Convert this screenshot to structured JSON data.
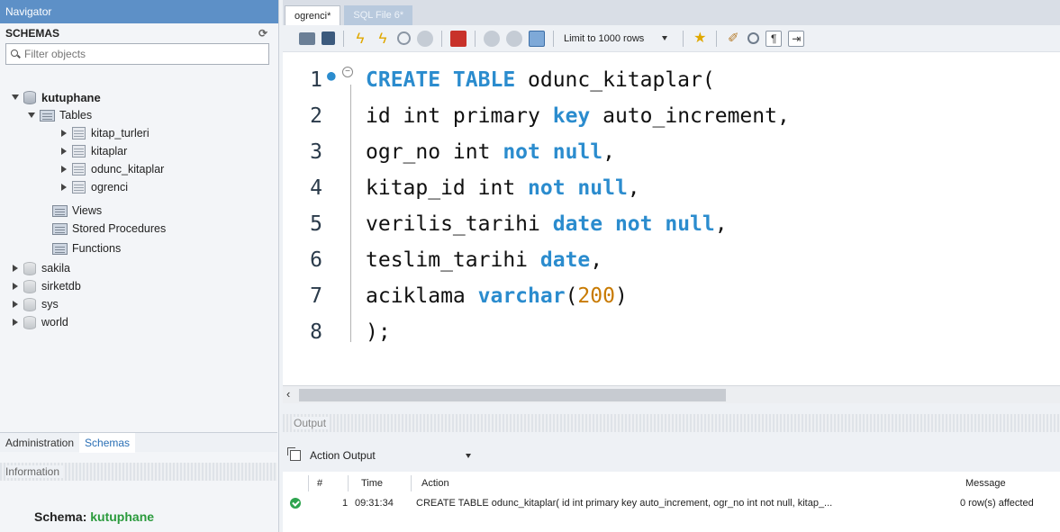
{
  "navigator": {
    "title": "Navigator",
    "schemas_label": "SCHEMAS",
    "filter_placeholder": "Filter objects",
    "tree": {
      "kutuphane": "kutuphane",
      "tables": "Tables",
      "table_items": [
        "kitap_turleri",
        "kitaplar",
        "odunc_kitaplar",
        "ogrenci"
      ],
      "views": "Views",
      "stored_procedures": "Stored Procedures",
      "functions": "Functions",
      "other_schemas": [
        "sakila",
        "sirketdb",
        "sys",
        "world"
      ]
    },
    "tabs": {
      "administration": "Administration",
      "schemas": "Schemas"
    },
    "information_label": "Information",
    "schema_prefix": "Schema:",
    "schema_name": "kutuphane"
  },
  "editor_tabs": [
    "ogrenci*",
    "SQL File 6*"
  ],
  "toolbar": {
    "limit_label": "Limit to 1000 rows"
  },
  "code": {
    "line_numbers": [
      "1",
      "2",
      "3",
      "4",
      "5",
      "6",
      "7",
      "8"
    ],
    "lines": [
      [
        {
          "t": "CREATE TABLE",
          "k": "kw"
        },
        {
          "t": " odunc_kitaplar(",
          "k": ""
        }
      ],
      [
        {
          "t": "id int primary ",
          "k": ""
        },
        {
          "t": "key",
          "k": "kw"
        },
        {
          "t": " auto_increment,",
          "k": ""
        }
      ],
      [
        {
          "t": "ogr_no int ",
          "k": ""
        },
        {
          "t": "not null",
          "k": "kw"
        },
        {
          "t": ",",
          "k": ""
        }
      ],
      [
        {
          "t": "kitap_id int ",
          "k": ""
        },
        {
          "t": "not null",
          "k": "kw"
        },
        {
          "t": ",",
          "k": ""
        }
      ],
      [
        {
          "t": "verilis_tarihi ",
          "k": ""
        },
        {
          "t": "date not null",
          "k": "kw"
        },
        {
          "t": ",",
          "k": ""
        }
      ],
      [
        {
          "t": "teslim_tarihi ",
          "k": ""
        },
        {
          "t": "date",
          "k": "kw"
        },
        {
          "t": ",",
          "k": ""
        }
      ],
      [
        {
          "t": "aciklama ",
          "k": ""
        },
        {
          "t": "varchar",
          "k": "kw"
        },
        {
          "t": "(",
          "k": ""
        },
        {
          "t": "200",
          "k": "num"
        },
        {
          "t": ")",
          "k": ""
        }
      ],
      [
        {
          "t": ");",
          "k": ""
        }
      ]
    ]
  },
  "output": {
    "title": "Output",
    "selector": "Action Output",
    "columns": {
      "num": "#",
      "time": "Time",
      "action": "Action",
      "message": "Message"
    },
    "rows": [
      {
        "num": "1",
        "time": "09:31:34",
        "action": "CREATE TABLE odunc_kitaplar( id int primary key auto_increment, ogr_no int not null, kitap_...",
        "message": "0 row(s) affected"
      }
    ]
  },
  "colors": {
    "accent": "#5d90c7",
    "keyword": "#2b8cce",
    "number": "#c87a00",
    "schema_green": "#2a9a3c",
    "success": "#2ea44f"
  },
  "icons": [
    "refresh-icon",
    "search-icon",
    "open-icon",
    "save-icon",
    "execute-icon",
    "execute-current-icon",
    "explain-icon",
    "stop-icon",
    "toggle-error-icon",
    "commit-icon",
    "rollback-icon",
    "autocommit-icon",
    "bookmark-icon",
    "beautify-icon",
    "find-icon",
    "invisible-chars-icon",
    "wrap-icon",
    "success-icon"
  ]
}
